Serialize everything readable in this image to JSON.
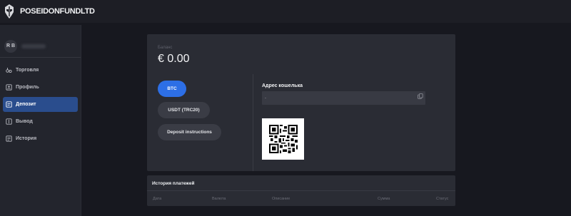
{
  "brand": {
    "name": "POSEIDONFUNDLTD",
    "logo_icon": "poseidon-helmet-icon"
  },
  "user": {
    "initials": "R B"
  },
  "sidebar": {
    "items": [
      {
        "label": "Торговля",
        "icon": "trading-icon",
        "active": false
      },
      {
        "label": "Профиль",
        "icon": "profile-icon",
        "active": false
      },
      {
        "label": "Депозит",
        "icon": "deposit-icon",
        "active": true
      },
      {
        "label": "Вывод",
        "icon": "withdraw-icon",
        "active": false
      },
      {
        "label": "История",
        "icon": "history-icon",
        "active": false
      }
    ]
  },
  "balance": {
    "label": "Баланс",
    "value": "€ 0.00"
  },
  "deposit": {
    "currencies": [
      "BTC",
      "USDT (TRC20)",
      "Deposit instructions"
    ],
    "selected": "BTC",
    "address_title": "Адрес кошелька",
    "address_value": "-",
    "copy_icon": "copy-icon",
    "qr_icon": "qr-code-icon"
  },
  "history": {
    "title": "История платежей",
    "columns": [
      "Дата",
      "Валюта",
      "Описание",
      "Сумма",
      "Статус"
    ]
  },
  "colors": {
    "accent": "#2d6fe6",
    "active_nav": "#2a4d8d",
    "card": "#2a2c34",
    "sidebar": "#23252d",
    "background": "#17181f"
  }
}
